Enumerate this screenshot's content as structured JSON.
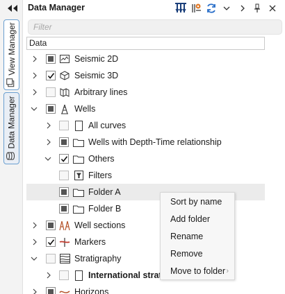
{
  "sidebar": {
    "collapse_icon": "double-left-arrow-icon",
    "tabs": [
      {
        "label": "View Manager",
        "icon": "window-stack-icon"
      },
      {
        "label": "Data Manager",
        "icon": "database-icon"
      }
    ]
  },
  "header": {
    "title": "Data Manager",
    "toolbar_icons": [
      "well-filter-icon",
      "settings-badge-icon",
      "refresh-icon",
      "chevron-down-icon",
      "chevron-right-icon",
      "pin-icon",
      "close-icon"
    ]
  },
  "filter": {
    "placeholder": "Filter"
  },
  "column_header": "Data",
  "tree": [
    {
      "label": "Seismic 2D",
      "level": 0,
      "expander": "collapsed",
      "check": "partial",
      "icon": "seismic-2d-icon"
    },
    {
      "label": "Seismic 3D",
      "level": 0,
      "expander": "collapsed",
      "check": "checked",
      "icon": "seismic-3d-icon"
    },
    {
      "label": "Arbitrary lines",
      "level": 0,
      "expander": "collapsed",
      "check": "empty",
      "icon": "arbitrary-lines-icon"
    },
    {
      "label": "Wells",
      "level": 0,
      "expander": "expanded",
      "check": "partial",
      "icon": "well-derrick-icon"
    },
    {
      "label": "All curves",
      "level": 1,
      "expander": "collapsed",
      "check": "empty",
      "icon": "page-icon"
    },
    {
      "label": "Wells with Depth-Time relationship",
      "level": 1,
      "expander": "collapsed",
      "check": "partial",
      "icon": "folder-icon"
    },
    {
      "label": "Others",
      "level": 1,
      "expander": "expanded",
      "check": "checked",
      "icon": "folder-icon"
    },
    {
      "label": "Filters",
      "level": 1,
      "expander": "none",
      "check": "empty",
      "icon": "filter-icon"
    },
    {
      "label": "Folder A",
      "level": 1,
      "expander": "none",
      "check": "partial",
      "icon": "folder-icon",
      "selected": true
    },
    {
      "label": "Folder B",
      "level": 1,
      "expander": "none",
      "check": "partial",
      "icon": "folder-icon"
    },
    {
      "label": "Well sections",
      "level": 0,
      "expander": "collapsed",
      "check": "partial",
      "icon": "well-sections-icon"
    },
    {
      "label": "Markers",
      "level": 0,
      "expander": "collapsed",
      "check": "checked",
      "icon": "markers-icon"
    },
    {
      "label": "Stratigraphy",
      "level": 0,
      "expander": "expanded",
      "check": "empty",
      "icon": "stratigraphy-icon"
    },
    {
      "label": "International strati",
      "level": 1,
      "expander": "collapsed",
      "check": "empty",
      "icon": "page-icon",
      "bold": true
    },
    {
      "label": "Horizons",
      "level": 0,
      "expander": "collapsed",
      "check": "partial",
      "icon": "horizons-icon"
    }
  ],
  "context_menu": {
    "items": [
      {
        "label": "Sort by name"
      },
      {
        "label": "Add folder"
      },
      {
        "label": "Rename"
      },
      {
        "label": "Remove"
      },
      {
        "label": "Move to folder",
        "submenu_glyph": "›"
      }
    ]
  }
}
